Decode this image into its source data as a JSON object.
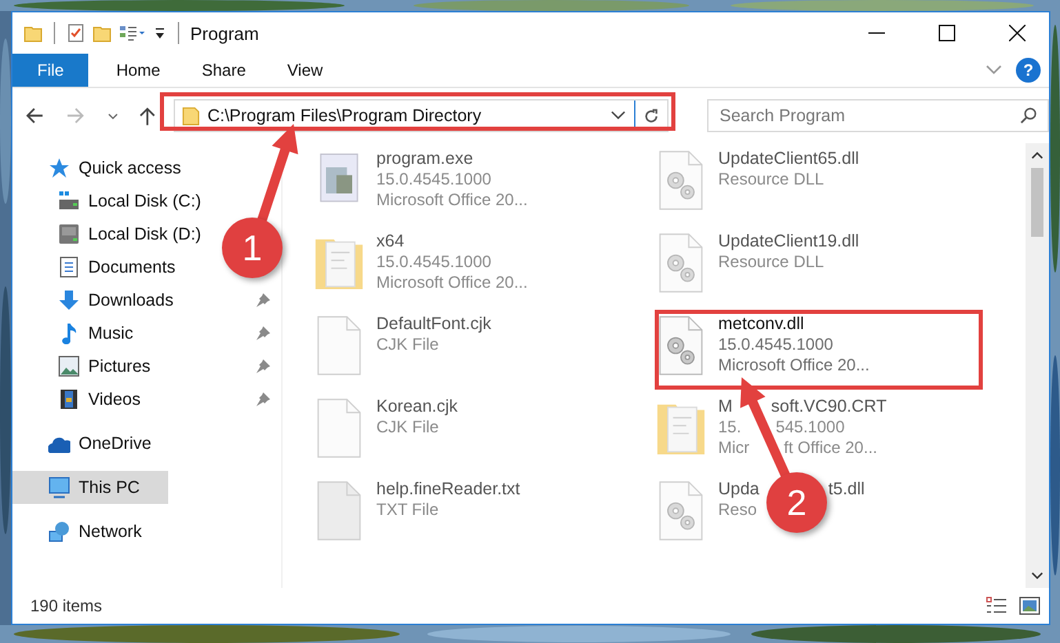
{
  "window": {
    "title": "Program",
    "help": "?"
  },
  "ribbon_tabs": [
    {
      "label": "File",
      "kind": "file"
    },
    {
      "label": "Home",
      "kind": "tab"
    },
    {
      "label": "Share",
      "kind": "tab"
    },
    {
      "label": "View",
      "kind": "tab"
    }
  ],
  "address": {
    "path": "C:\\Program Files\\Program Directory"
  },
  "search": {
    "placeholder": "Search Program"
  },
  "sidebar": {
    "items": [
      {
        "label": "Quick access",
        "kind": "star",
        "pinned": false,
        "selected": false,
        "children": [
          {
            "label": "Local Disk (C:)",
            "kind": "system-drive",
            "pinned": false,
            "selected": false
          },
          {
            "label": "Local Disk (D:)",
            "kind": "drive",
            "pinned": false,
            "selected": false
          },
          {
            "label": "Documents",
            "kind": "documents",
            "pinned": false,
            "selected": false
          },
          {
            "label": "Downloads",
            "kind": "downloads",
            "pinned": true,
            "selected": false
          },
          {
            "label": "Music",
            "kind": "music",
            "pinned": true,
            "selected": false
          },
          {
            "label": "Pictures",
            "kind": "pictures",
            "pinned": true,
            "selected": false
          },
          {
            "label": "Videos",
            "kind": "videos",
            "pinned": true,
            "selected": false
          }
        ]
      },
      {
        "label": "OneDrive",
        "kind": "cloud",
        "pinned": false,
        "selected": false
      },
      {
        "label": "This PC",
        "kind": "pc",
        "pinned": false,
        "selected": true
      },
      {
        "label": "Network",
        "kind": "network",
        "pinned": false,
        "selected": false
      }
    ]
  },
  "files": [
    {
      "name": [
        "program.exe"
      ],
      "details": [
        [
          "15.0.4545.1000"
        ],
        [
          "Microsoft Office 20..."
        ]
      ],
      "kind": "exe",
      "blurred": true
    },
    {
      "name": [
        "UpdateClient65.dll"
      ],
      "details": [
        [
          "Resource DLL"
        ]
      ],
      "kind": "dll",
      "blurred": true
    },
    {
      "name": [
        "x64"
      ],
      "details": [
        [
          "15.0.4545.1000"
        ],
        [
          "Microsoft Office 20..."
        ]
      ],
      "kind": "folder",
      "blurred": true
    },
    {
      "name": [
        "UpdateClient19.dll"
      ],
      "details": [
        [
          "Resource DLL"
        ]
      ],
      "kind": "dll",
      "blurred": true
    },
    {
      "name": [
        "DefaultFont.cjk"
      ],
      "details": [
        [
          "CJK File"
        ]
      ],
      "kind": "file",
      "blurred": true
    },
    {
      "name": [
        "metconv.dll"
      ],
      "details": [
        [
          "15.0.4545.1000"
        ],
        [
          "Microsoft Office 20..."
        ]
      ],
      "kind": "dll",
      "blurred": false
    },
    {
      "name": [
        "Korean.cjk"
      ],
      "details": [
        [
          "CJK File"
        ]
      ],
      "kind": "file",
      "blurred": true
    },
    {
      "name": [
        "M",
        "soft.VC90.CRT"
      ],
      "details": [
        [
          "15.",
          "545.1000"
        ],
        [
          "Micr",
          "ft Office 20..."
        ]
      ],
      "kind": "folder",
      "blurred": true
    },
    {
      "name": [
        "help.fineReader.txt"
      ],
      "details": [
        [
          "TXT File"
        ]
      ],
      "kind": "txt",
      "blurred": true
    },
    {
      "name": [
        "Upda",
        "t5.dll"
      ],
      "details": [
        [
          "Reso"
        ]
      ],
      "kind": "dll",
      "blurred": true
    }
  ],
  "status_bar": {
    "item_count": "190 items"
  },
  "annotations": [
    {
      "label": "1"
    },
    {
      "label": "2"
    }
  ]
}
